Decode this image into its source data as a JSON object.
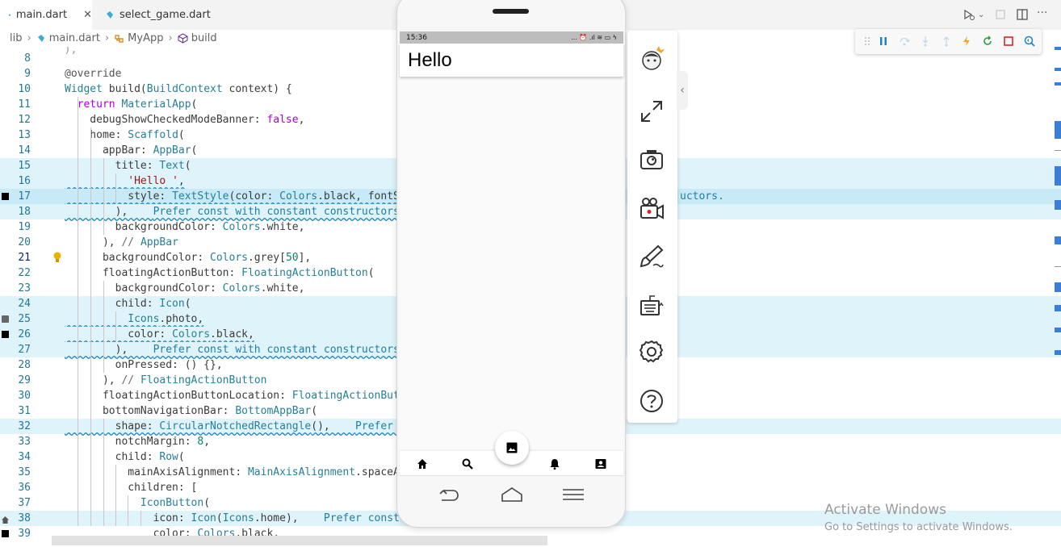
{
  "tabs": [
    {
      "label": "main.dart",
      "active": true,
      "icon": "dart-icon"
    },
    {
      "label": "select_game.dart",
      "active": false,
      "icon": "dart-icon"
    }
  ],
  "breadcrumb": {
    "root": "lib",
    "file": "main.dart",
    "cls": "MyApp",
    "method": "build"
  },
  "code": {
    "lines": [
      {
        "n": "8",
        "text": ""
      },
      {
        "n": "9",
        "text": "@override"
      },
      {
        "n": "10",
        "text": "Widget build(BuildContext context) {"
      },
      {
        "n": "11",
        "text": "  return MaterialApp("
      },
      {
        "n": "12",
        "text": "    debugShowCheckedModeBanner: false,"
      },
      {
        "n": "13",
        "text": "    home: Scaffold("
      },
      {
        "n": "14",
        "text": "      appBar: AppBar("
      },
      {
        "n": "15",
        "text": "        title: Text("
      },
      {
        "n": "16",
        "text": "          'Hello ',"
      },
      {
        "n": "17",
        "text": "          style: TextStyle(color: Colors.black, fontSi"
      },
      {
        "n": "18",
        "text": "        ),    Prefer const with constant constructors."
      },
      {
        "n": "19",
        "text": "        backgroundColor: Colors.white,"
      },
      {
        "n": "20",
        "text": "      ), // AppBar"
      },
      {
        "n": "21",
        "text": "      backgroundColor: Colors.grey[50],"
      },
      {
        "n": "22",
        "text": "      floatingActionButton: FloatingActionButton("
      },
      {
        "n": "23",
        "text": "        backgroundColor: Colors.white,"
      },
      {
        "n": "24",
        "text": "        child: Icon("
      },
      {
        "n": "25",
        "text": "          Icons.photo,"
      },
      {
        "n": "26",
        "text": "          color: Colors.black,"
      },
      {
        "n": "27",
        "text": "        ),    Prefer const with constant constructors."
      },
      {
        "n": "28",
        "text": "        onPressed: () {},"
      },
      {
        "n": "29",
        "text": "      ), // FloatingActionButton"
      },
      {
        "n": "30",
        "text": "      floatingActionButtonLocation: FloatingActionButt"
      },
      {
        "n": "31",
        "text": "      bottomNavigationBar: BottomAppBar("
      },
      {
        "n": "32",
        "text": "        shape: CircularNotchedRectangle(),    Prefer c"
      },
      {
        "n": "33",
        "text": "        notchMargin: 8,"
      },
      {
        "n": "34",
        "text": "        child: Row("
      },
      {
        "n": "35",
        "text": "          mainAxisAlignment: MainAxisAlignment.spaceAr"
      },
      {
        "n": "36",
        "text": "          children: ["
      },
      {
        "n": "37",
        "text": "            IconButton("
      },
      {
        "n": "38",
        "text": "              icon: Icon(Icons.home),    Prefer const w"
      },
      {
        "n": "39",
        "text": "              color: Colors.black,"
      }
    ],
    "line17_overflow": "uctors.",
    "hint_text": "Prefer const with constant constructors."
  },
  "phone": {
    "status_time": "15:36",
    "status_icons": "... ⏰ .ıl ≋ ▭ ϟ",
    "appbar_title": "Hello",
    "bottom_icons": [
      "home-icon",
      "search-icon",
      "notifications-icon",
      "contact-icon"
    ],
    "fab_icon": "photo-icon",
    "nav_icons": [
      "back-icon",
      "home-nav-icon",
      "menu-icon"
    ]
  },
  "sidetool": [
    "mascot-icon",
    "fullscreen-icon",
    "screenshot-icon",
    "record-icon",
    "brush-icon",
    "keyboard-icon",
    "settings-icon",
    "help-icon"
  ],
  "debugbar": [
    "drag-handle-icon",
    "pause-icon",
    "step-over-icon",
    "step-into-icon",
    "step-out-icon",
    "hot-reload-icon",
    "restart-icon",
    "stop-icon",
    "devtools-icon"
  ],
  "watermark": {
    "title": "Activate Windows",
    "subtitle": "Go to Settings to activate Windows."
  },
  "colors": {
    "accent": "#3a7fd5",
    "line_highlight": "#dff3fa",
    "hint": "#1f7ea3"
  }
}
